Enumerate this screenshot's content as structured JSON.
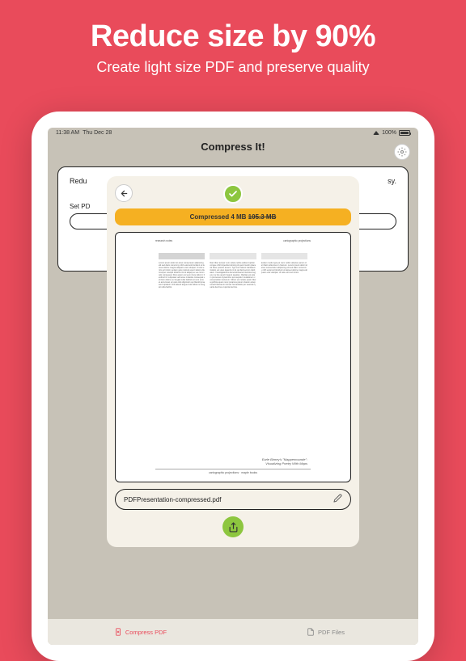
{
  "hero": {
    "title": "Reduce size by 90%",
    "subtitle": "Create light size PDF and preserve quality"
  },
  "status": {
    "time": "11:38 AM",
    "date": "Thu Dec 28",
    "battery_pct": "100%"
  },
  "app": {
    "title": "Compress It!"
  },
  "bg_card": {
    "title_left": "Redu",
    "title_right": "sy.",
    "sub_left": "Set PD"
  },
  "modal": {
    "banner_prefix": "Compressed 4 MB ",
    "banner_strike": "105.3 MB",
    "filename": "PDFPresentation-compressed.pdf",
    "doc_header_left": "research notes",
    "doc_header_right": "cartographic projections",
    "doc_sig_line1": "Earle Birney's \"Mappemounde\":",
    "doc_sig_line2": "Visualizing Poetry With Maps",
    "doc_footer": "cartographic projections · maple books"
  },
  "tabs": {
    "compress": "Compress PDF",
    "files": "PDF Files"
  }
}
